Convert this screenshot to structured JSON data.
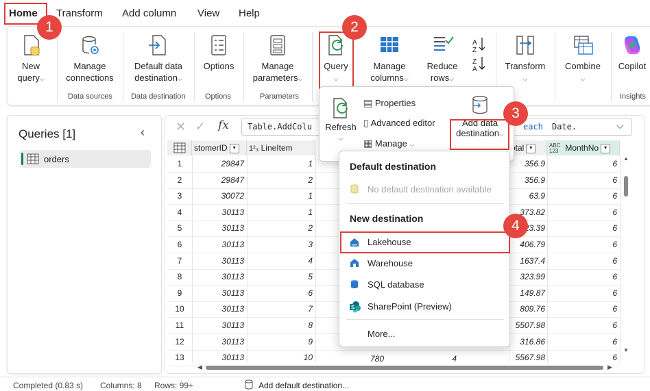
{
  "tabs": [
    "Home",
    "Transform",
    "Add column",
    "View",
    "Help"
  ],
  "ribbon": {
    "new_query": [
      "New",
      "query"
    ],
    "manage_connections": [
      "Manage",
      "connections"
    ],
    "data_sources": "Data sources",
    "default_data_destination": [
      "Default data",
      "destination"
    ],
    "data_destination": "Data destination",
    "options_btn": "Options",
    "options_group": "Options",
    "manage_parameters": [
      "Manage",
      "parameters"
    ],
    "parameters_group": "Parameters",
    "query": "Query",
    "manage_columns": [
      "Manage",
      "columns"
    ],
    "reduce_rows": [
      "Reduce",
      "rows"
    ],
    "transform": "Transform",
    "combine": "Combine",
    "copilot": "Copilot",
    "insights_group": "Insights"
  },
  "query_popup": {
    "refresh": "Refresh",
    "properties": "Properties",
    "advanced_editor": "Advanced editor",
    "manage": "Manage",
    "add_data_destination": [
      "Add data",
      "destination"
    ]
  },
  "destination_menu": {
    "default_heading": "Default destination",
    "no_default": "No default destination available",
    "new_heading": "New destination",
    "items": [
      "Lakehouse",
      "Warehouse",
      "SQL database",
      "SharePoint (Preview)"
    ],
    "more": "More..."
  },
  "queries_panel": {
    "title": "Queries [1]",
    "items": [
      "orders"
    ]
  },
  "formula": {
    "left": "Table.AddColu",
    "each": "each",
    "right": "Date."
  },
  "columns": {
    "customer_id": "stomerID",
    "line_item_type": "1²₃",
    "line_item": "LineItem",
    "total": "otal",
    "month_type": "ABC 123",
    "month_no": "MonthNo"
  },
  "rows": [
    {
      "n": "1",
      "cust": "29847",
      "line": "1",
      "tot": "356.9",
      "mon": "6"
    },
    {
      "n": "2",
      "cust": "29847",
      "line": "2",
      "tot": "356.9",
      "mon": "6"
    },
    {
      "n": "3",
      "cust": "30072",
      "line": "1",
      "tot": "63.9",
      "mon": "6"
    },
    {
      "n": "4",
      "cust": "30113",
      "line": "1",
      "tot": "373.82",
      "mon": "6"
    },
    {
      "n": "5",
      "cust": "30113",
      "line": "2",
      "tot": "223.39",
      "mon": "6"
    },
    {
      "n": "6",
      "cust": "30113",
      "line": "3",
      "tot": "406.79",
      "mon": "6"
    },
    {
      "n": "7",
      "cust": "30113",
      "line": "4",
      "tot": "1637.4",
      "mon": "6"
    },
    {
      "n": "8",
      "cust": "30113",
      "line": "5",
      "tot": "323.99",
      "mon": "6"
    },
    {
      "n": "9",
      "cust": "30113",
      "line": "6",
      "tot": "149.87",
      "mon": "6"
    },
    {
      "n": "10",
      "cust": "30113",
      "line": "7",
      "tot": "809.76",
      "mon": "6"
    },
    {
      "n": "11",
      "cust": "30113",
      "line": "8",
      "tot": "5507.98",
      "mon": "6"
    },
    {
      "n": "12",
      "cust": "30113",
      "line": "9",
      "tot": "316.86",
      "mon": "6"
    },
    {
      "n": "13",
      "cust": "30113",
      "line": "10",
      "tot": "5567.98",
      "mon": "6"
    }
  ],
  "row13_extra": {
    "a": "780",
    "b": "4"
  },
  "status": {
    "completed": "Completed (0.83 s)",
    "columns": "Columns: 8",
    "rows": "Rows: 99+",
    "add_default": "Add default destination..."
  },
  "badges": [
    "1",
    "2",
    "3",
    "4"
  ],
  "colors": {
    "accent_red": "#e5463f",
    "active_green": "#1b7d4f"
  }
}
